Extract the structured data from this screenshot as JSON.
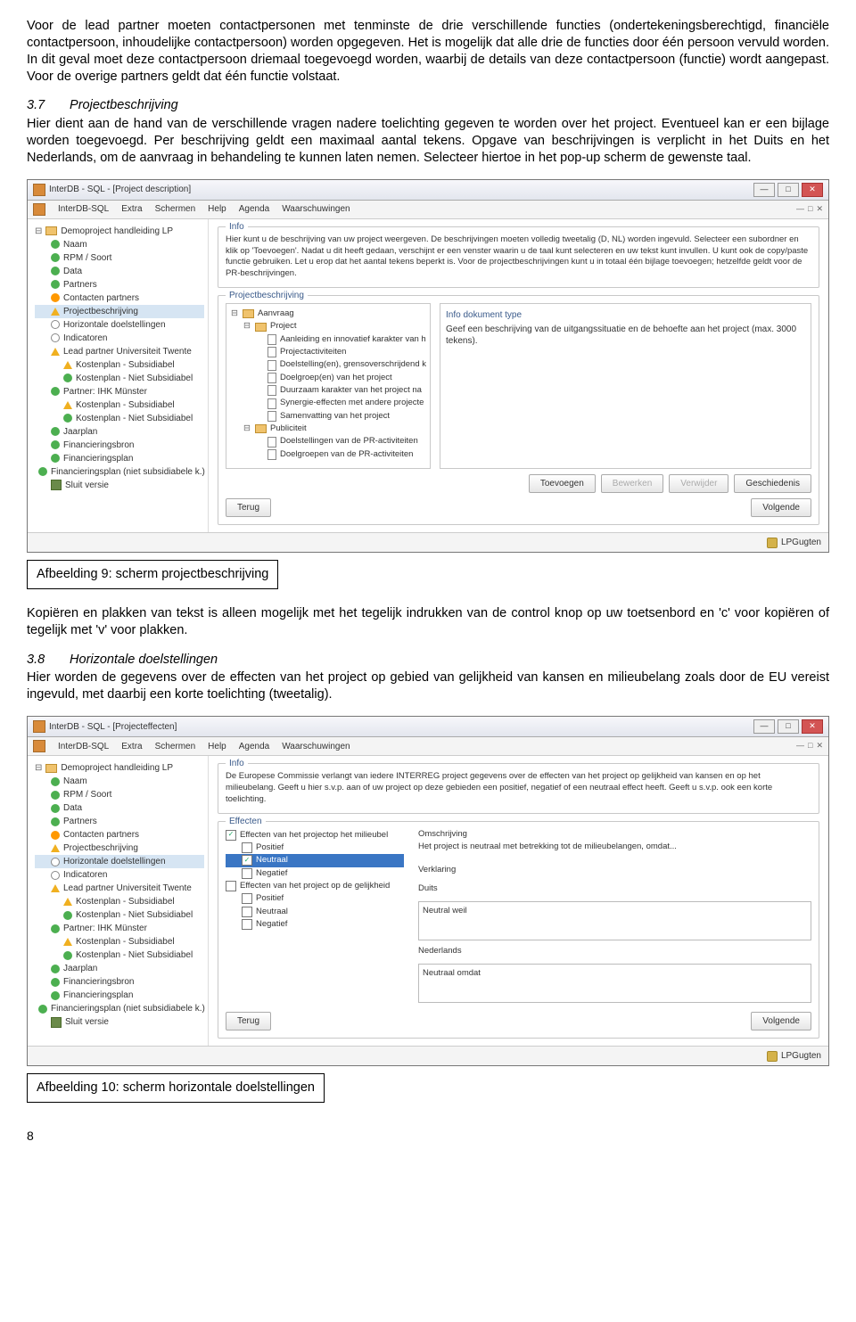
{
  "paragraphs": {
    "p1": "Voor de lead partner moeten contactpersonen met tenminste de drie verschillende functies (ondertekeningsberechtigd, financiële contactpersoon, inhoudelijke contactpersoon) worden opgegeven. Het is mogelijk dat alle drie de functies door één persoon vervuld worden. In dit geval moet deze contactpersoon driemaal toegevoegd worden, waarbij de details van deze contactpersoon (functie) wordt aangepast. Voor de overige partners geldt dat één functie volstaat.",
    "sec37_num": "3.7",
    "sec37_title": "Projectbeschrijving",
    "p2": "Hier dient aan de hand van de verschillende vragen nadere toelichting gegeven te worden over het project. Eventueel kan er een bijlage worden toegevoegd. Per beschrijving geldt een maximaal aantal tekens. Opgave van beschrijvingen is verplicht in het Duits en het Nederlands, om de aanvraag in behandeling te kunnen laten nemen. Selecteer hiertoe in het pop-up scherm de gewenste taal.",
    "caption9": "Afbeelding 9: scherm projectbeschrijving",
    "p3": "Kopiëren en plakken van tekst is alleen mogelijk met het tegelijk indrukken van de control knop op uw toetsenbord en 'c' voor kopiëren of tegelijk met 'v' voor plakken.",
    "sec38_num": "3.8",
    "sec38_title": "Horizontale doelstellingen",
    "p4": "Hier worden de gegevens over de effecten van het project op gebied van gelijkheid van kansen en milieubelang zoals door de EU vereist ingevuld, met daarbij een korte toelichting (tweetalig).",
    "caption10": "Afbeelding 10: scherm horizontale doelstellingen",
    "page_num": "8"
  },
  "app": {
    "title1": "InterDB - SQL - [Project description]",
    "title2": "InterDB - SQL - [Projecteffecten]",
    "brand": "InterDB-SQL",
    "menu": [
      "Extra",
      "Schermen",
      "Help",
      "Agenda",
      "Waarschuwingen"
    ],
    "root": "Demoproject handleiding LP",
    "tree": [
      {
        "icon": "green",
        "label": "Naam"
      },
      {
        "icon": "green",
        "label": "RPM / Soort"
      },
      {
        "icon": "green",
        "label": "Data"
      },
      {
        "icon": "green",
        "label": "Partners"
      },
      {
        "icon": "orange",
        "label": "Contacten partners"
      },
      {
        "icon": "warn",
        "label": "Projectbeschrijving",
        "sel": true
      },
      {
        "icon": "circle",
        "label": "Horizontale doelstellingen"
      },
      {
        "icon": "circle",
        "label": "Indicatoren"
      },
      {
        "icon": "warn",
        "label": "Lead partner Universiteit Twente"
      },
      {
        "icon": "warn",
        "label": "Kostenplan - Subsidiabel",
        "indent": 2
      },
      {
        "icon": "green",
        "label": "Kostenplan - Niet Subsidiabel",
        "indent": 2
      },
      {
        "icon": "green",
        "label": "Partner: IHK Münster"
      },
      {
        "icon": "warn",
        "label": "Kostenplan - Subsidiabel",
        "indent": 2
      },
      {
        "icon": "green",
        "label": "Kostenplan - Niet Subsidiabel",
        "indent": 2
      },
      {
        "icon": "green",
        "label": "Jaarplan"
      },
      {
        "icon": "green",
        "label": "Financieringsbron"
      },
      {
        "icon": "green",
        "label": "Financieringsplan"
      },
      {
        "icon": "green",
        "label": "Financieringsplan (niet subsidiabele k.)"
      },
      {
        "icon": "exit",
        "label": "Sluit versie"
      }
    ],
    "tree2_sel": "Horizontale doelstellingen",
    "info_label": "Info",
    "info1": "Hier kunt u de beschrijving van uw project weergeven. De beschrijvingen moeten volledig tweetalig (D, NL) worden ingevuld. Selecteer een subordner en klik op 'Toevoegen'. Nadat u dit heeft gedaan, verschijnt er een venster waarin u de taal kunt selecteren en uw tekst kunt invullen. U kunt ook de copy/paste functie gebruiken. Let u erop dat het aantal tekens beperkt is. Voor de projectbeschrijvingen kunt u in totaal één bijlage toevoegen; hetzelfde geldt voor de PR-beschrijvingen.",
    "info2": "De Europese Commissie verlangt van iedere INTERREG project gegevens over de effecten van het project op gelijkheid van kansen en op het milieubelang. Geeft u hier s.v.p. aan of uw project op deze gebieden een positief, negatief of een neutraal effect heeft. Geeft u s.v.p. ook een korte toelichting.",
    "group_pb": "Projectbeschrijving",
    "infodoc_label": "Info dokument type",
    "infodoc_text": "Geef een beschrijving van de uitgangssituatie en de behoefte aan het project (max. 3000 tekens).",
    "inner_tree": [
      {
        "d": 0,
        "f": 1,
        "label": "Aanvraag"
      },
      {
        "d": 1,
        "f": 1,
        "label": "Project"
      },
      {
        "d": 2,
        "f": 0,
        "label": "Aanleiding en innovatief karakter van h"
      },
      {
        "d": 2,
        "f": 0,
        "label": "Projectactiviteiten"
      },
      {
        "d": 2,
        "f": 0,
        "label": "Doelstelling(en), grensoverschrijdend k"
      },
      {
        "d": 2,
        "f": 0,
        "label": "Doelgroep(en) van het project"
      },
      {
        "d": 2,
        "f": 0,
        "label": "Duurzaam karakter van het project na"
      },
      {
        "d": 2,
        "f": 0,
        "label": "Synergie-effecten met andere projecte"
      },
      {
        "d": 2,
        "f": 0,
        "label": "Samenvatting van het project"
      },
      {
        "d": 1,
        "f": 1,
        "label": "Publiciteit"
      },
      {
        "d": 2,
        "f": 0,
        "label": "Doelstellingen van de PR-activiteiten"
      },
      {
        "d": 2,
        "f": 0,
        "label": "Doelgroepen van de PR-activiteiten"
      }
    ],
    "buttons": {
      "add": "Toevoegen",
      "edit": "Bewerken",
      "del": "Verwijder",
      "hist": "Geschiedenis",
      "back": "Terug",
      "next": "Volgende"
    },
    "user": "LPGugten",
    "eff": {
      "group": "Effecten",
      "desc_label": "Omschrijving",
      "desc_text": "Het project is neutraal met betrekking tot de milieubelangen, omdat...",
      "root1": "Effecten van het projectop het milieubel",
      "root2": "Effecten van het project op de gelijkheid",
      "opts": [
        "Positief",
        "Neutraal",
        "Negatief"
      ],
      "verklaring": "Verklaring",
      "duits": "Duits",
      "nl": "Nederlands",
      "txt_d": "Neutral weil",
      "txt_nl": "Neutraal omdat"
    }
  }
}
